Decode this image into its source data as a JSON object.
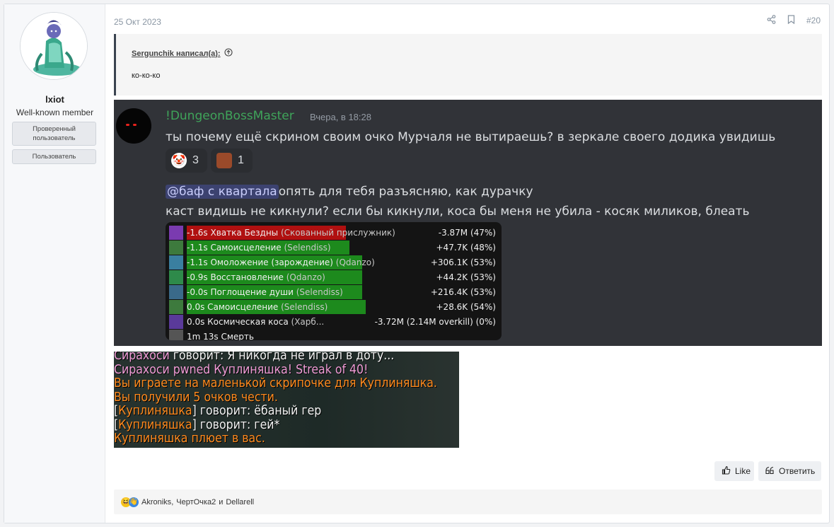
{
  "user": {
    "name": "lxiot",
    "title": "Well-known member",
    "badges": [
      "Проверенный пользователь",
      "Пользователь"
    ]
  },
  "post": {
    "date": "25 Окт 2023",
    "number": "#20",
    "quote": {
      "author": "Sergunchik написал(а):",
      "text": "ко-ко-ко"
    },
    "like_label": "Like",
    "reply_label": "Ответить",
    "reactions": {
      "users": [
        "Akroniks",
        "ЧертОчка2"
      ],
      "conjunction": "и",
      "last_user": "Dellarell"
    }
  },
  "discord": {
    "author": "!DungeonBossMaster",
    "timestamp": "Вчера, в 18:28",
    "message1": "ты почему ещё скрином своим очко Мурчаля не вытираешь? в зеркале своего додика увидишь",
    "reactions": [
      {
        "icon": "clown-emoji-icon",
        "count": "3"
      },
      {
        "icon": "custom-emoji-icon",
        "count": "1"
      }
    ],
    "mention": "@баф с квартала",
    "message2_rest": "опять для тебя разъясняю, как дурачку",
    "message3": "каст видишь не кикнули? если бы кикнули, коса бы меня не убила - косяк миликов, блеать",
    "combat_log": [
      {
        "name": "-1.6s Хватка Бездны",
        "detail": "(Скованный прислужник)",
        "value": "-3.87M (47%)",
        "bar_color": "#b01010",
        "bar_fraction": 0.49,
        "icon_color": "#7a3bb0"
      },
      {
        "name": "-1.1s Самоисцеление",
        "detail": "(Selendiss)",
        "value": "+47.7K (48%)",
        "bar_color": "#1d8a1d",
        "bar_fraction": 0.5,
        "icon_color": "#3d7a3d"
      },
      {
        "name": "-1.1s Омоложение (зарождение)",
        "detail": "(Qdanzo)",
        "value": "+306.1K (53%)",
        "bar_color": "#1d8a1d",
        "bar_fraction": 0.54,
        "icon_color": "#3a7fa0"
      },
      {
        "name": "-0.9s Восстановление",
        "detail": "(Qdanzo)",
        "value": "+44.2K (53%)",
        "bar_color": "#1d8a1d",
        "bar_fraction": 0.54,
        "icon_color": "#2e8a4a"
      },
      {
        "name": "-0.0s Поглощение души",
        "detail": "(Selendiss)",
        "value": "+216.4K (53%)",
        "bar_color": "#1d8a1d",
        "bar_fraction": 0.54,
        "icon_color": "#3a6a8a"
      },
      {
        "name": "0.0s Самоисцеление",
        "detail": "(Selendiss)",
        "value": "+28.6K (54%)",
        "bar_color": "#1d8a1d",
        "bar_fraction": 0.55,
        "icon_color": "#3d7a3d"
      },
      {
        "name": "0.0s Космическая коса",
        "detail": "(Харб...",
        "value": "-3.72M (2.14M overkill) (0%)",
        "bar_color": "#141414",
        "bar_fraction": 0,
        "icon_color": "#5a3a9a"
      },
      {
        "name": "1m 13s Смерть",
        "detail": "",
        "value": "",
        "bar_color": "#141414",
        "bar_fraction": 0,
        "icon_color": "#555555"
      }
    ]
  },
  "wow_chat": [
    {
      "segments": [
        {
          "text": "Сирахоси",
          "color": "pink"
        },
        {
          "text": " говорит: Я никогда не играл в доту...",
          "color": "white"
        }
      ]
    },
    {
      "segments": [
        {
          "text": "Сирахоси pwned Куплиняшка! Streak of 40!",
          "color": "pink"
        }
      ]
    },
    {
      "segments": [
        {
          "text": "Вы играете на маленькой скрипочке для Куплиняшка.",
          "color": "orange"
        }
      ]
    },
    {
      "segments": [
        {
          "text": "Вы получили 5 очков чести.",
          "color": "orange"
        }
      ]
    },
    {
      "segments": [
        {
          "text": "[",
          "color": "white"
        },
        {
          "text": "Куплиняшка",
          "color": "orange"
        },
        {
          "text": "] говорит: ёбаный гер",
          "color": "white"
        }
      ]
    },
    {
      "segments": [
        {
          "text": "[",
          "color": "white"
        },
        {
          "text": "Куплиняшка",
          "color": "orange"
        },
        {
          "text": "] говорит: гей*",
          "color": "white"
        }
      ]
    },
    {
      "segments": [
        {
          "text": "Куплиняшка плюет в вас.",
          "color": "orange"
        }
      ]
    }
  ]
}
